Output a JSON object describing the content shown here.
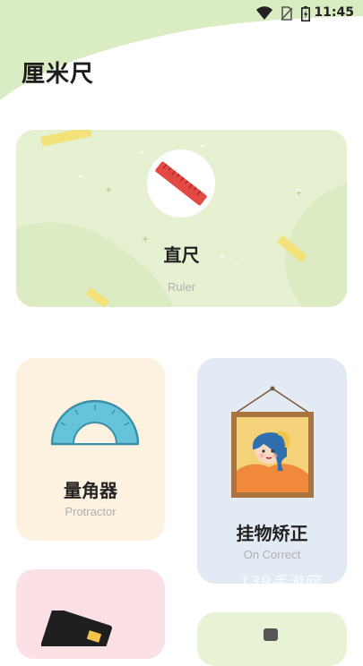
{
  "status_bar": {
    "time": "11:45",
    "icons": [
      "wifi-icon",
      "no-sim-icon",
      "battery-charging-icon"
    ]
  },
  "app": {
    "title": "厘米尺"
  },
  "cards": [
    {
      "id": "ruler",
      "title": "直尺",
      "subtitle": "Ruler",
      "icon": "ruler-icon"
    },
    {
      "id": "protractor",
      "title": "量角器",
      "subtitle": "Protractor",
      "icon": "protractor-icon"
    },
    {
      "id": "correct",
      "title": "挂物矫正",
      "subtitle": "On Correct",
      "icon": "framed-painting-icon"
    }
  ],
  "watermark": "139手游网",
  "colors": {
    "header_green": "#d9ecc2",
    "ruler_card": "#e6f1d2",
    "protractor_card": "#fdf1df",
    "correct_card": "#e2eaf3",
    "bottom_left_card": "#fbe1e6",
    "bottom_right_card": "#e8f3d6"
  }
}
